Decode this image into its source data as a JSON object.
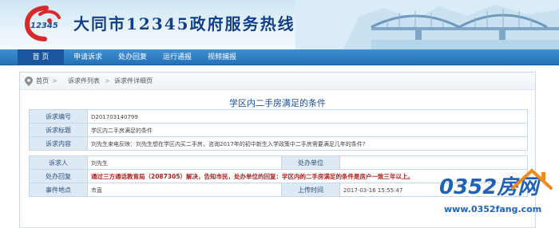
{
  "header": {
    "logo_text": "12345",
    "site_title": "大同市12345政府服务热线"
  },
  "nav": {
    "items": [
      {
        "label": "首 页"
      },
      {
        "label": "申请诉求"
      },
      {
        "label": "处办回复"
      },
      {
        "label": "运行通报"
      },
      {
        "label": "视频捕报"
      }
    ]
  },
  "breadcrumb": {
    "items": [
      "首页",
      "诉求件列表",
      "诉求件详细页"
    ]
  },
  "detail": {
    "title": "学区内二手房满足的条件",
    "fields": {
      "number_label": "诉求编号",
      "number_value": "D201703140799",
      "subject_label": "诉求标题",
      "subject_value": "学区内二手房满足的条件",
      "content_label": "诉求内容",
      "content_value": "刘先生来电反映：刘先生想在学区内买二手房，咨询2017年的初中新生入学政策中二手房需要满足几年的条件?",
      "person_label": "诉求人",
      "person_value": "刘先生",
      "unit_label": "处办单位",
      "unit_value": "",
      "reply_label": "处办回复",
      "reply_value": "通过三方通话教育局（2087305）解决，告知市民，处办单位的回复：学区内的二手房满足的条件是房户一致三年以上。",
      "location_label": "事件地点",
      "location_value": "市直",
      "time_label": "上传时间",
      "time_value": "2017-03-16 15:55:47"
    }
  },
  "watermark": {
    "main": "0352房网",
    "url": "www.0352fang.com"
  },
  "colors": {
    "nav_bg": "#2570b8",
    "nav_active": "#1a55a0",
    "label_bg": "#dde9f5",
    "title_blue": "#1b4f9c",
    "reply_red": "#b21e1e"
  }
}
